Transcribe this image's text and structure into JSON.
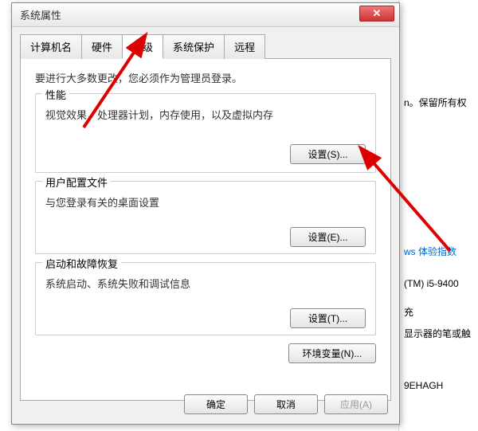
{
  "dialog": {
    "title": "系统属性",
    "close": "✕"
  },
  "tabs": {
    "computer_name": "计算机名",
    "hardware": "硬件",
    "advanced": "高级",
    "system_protection": "系统保护",
    "remote": "远程"
  },
  "intro": "要进行大多数更改，您必须作为管理员登录。",
  "performance": {
    "title": "性能",
    "desc": "视觉效果，处理器计划，内存使用，以及虚拟内存",
    "button": "设置(S)..."
  },
  "user_profiles": {
    "title": "用户配置文件",
    "desc": "与您登录有关的桌面设置",
    "button": "设置(E)..."
  },
  "startup": {
    "title": "启动和故障恢复",
    "desc": "系统启动、系统失败和调试信息",
    "button": "设置(T)..."
  },
  "env_vars": "环境变量(N)...",
  "footer": {
    "ok": "确定",
    "cancel": "取消",
    "apply": "应用(A)"
  },
  "background": {
    "line1": "n。保留所有权",
    "link": "ws 体验指数",
    "cpu": "(TM) i5-9400",
    "line3": "充",
    "line4": "显示器的笔或触",
    "line5": "9EHAGH"
  }
}
